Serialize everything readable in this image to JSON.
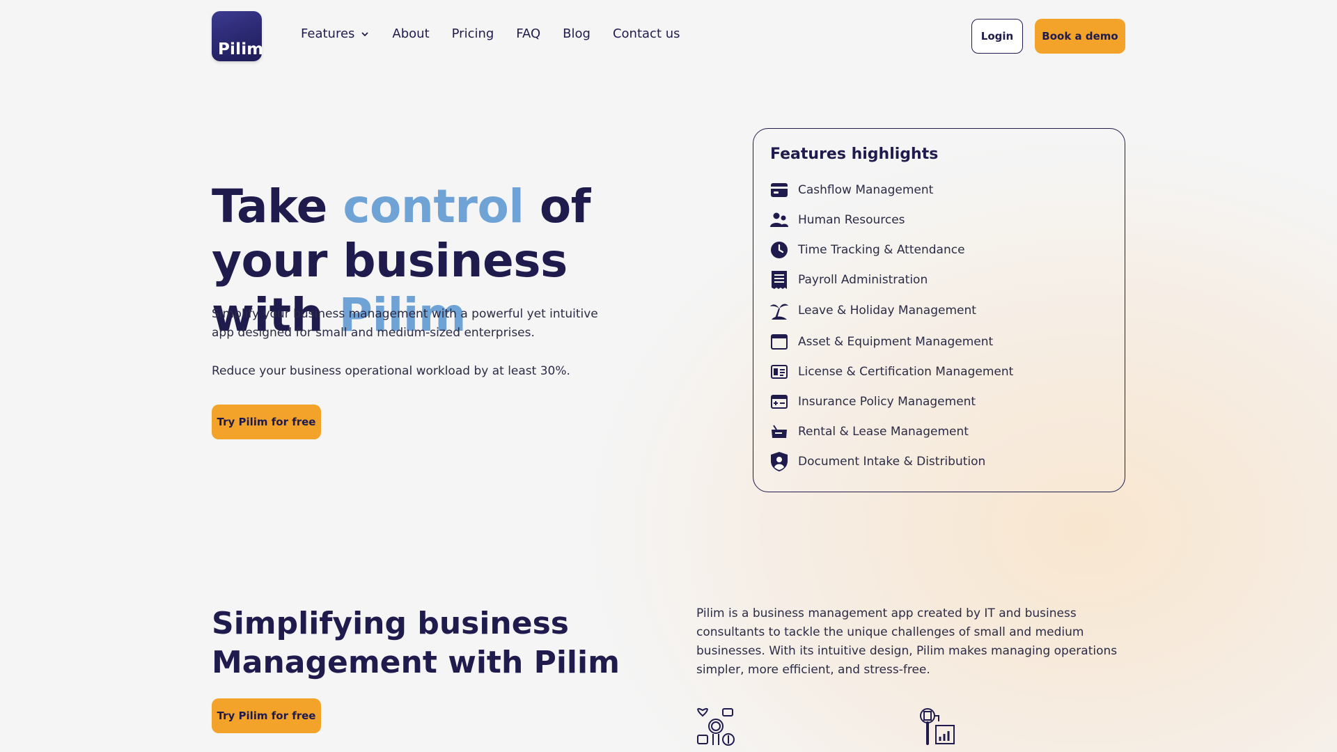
{
  "nav": {
    "logo_text": "Pilim",
    "links": [
      "Features",
      "About",
      "Pricing",
      "FAQ",
      "Blog",
      "Contact us"
    ],
    "login_label": "Login",
    "demo_label": "Book a demo"
  },
  "hero": {
    "title_part1": "Take ",
    "title_accent1": "control",
    "title_part2": " of your business with ",
    "title_accent2": "Pilim",
    "para1": "Simplify your business management with a powerful yet intuitive app designed for small and medium-sized enterprises.",
    "para2": "Reduce your business operational workload by at least 30%.",
    "cta_label": "Try Pilim for free"
  },
  "features": {
    "heading": "Features highlights",
    "items": [
      {
        "label": "Cashflow Management",
        "icon": "wallet-icon"
      },
      {
        "label": "Human Resources",
        "icon": "people-icon"
      },
      {
        "label": "Time Tracking & Attendance",
        "icon": "clock-icon"
      },
      {
        "label": "Payroll Administration",
        "icon": "receipt-icon"
      },
      {
        "label": "Leave & Holiday Management",
        "icon": "palm-tree-icon"
      },
      {
        "label": "Asset & Equipment Management",
        "icon": "window-icon"
      },
      {
        "label": "License & Certification Management",
        "icon": "id-card-icon"
      },
      {
        "label": "Insurance Policy Management",
        "icon": "medical-card-icon"
      },
      {
        "label": "Rental & Lease Management",
        "icon": "rent-tag-icon"
      },
      {
        "label": "Document Intake & Distribution",
        "icon": "user-shield-icon"
      }
    ]
  },
  "section2": {
    "title": "Simplifying business Management with Pilim",
    "para": "Pilim is a business management app created by IT and business consultants to tackle the unique challenges of small and medium businesses. With its intuitive design, Pilim makes managing operations simpler, more efficient, and stress-free.",
    "cta_label": "Try Pilim for free"
  },
  "colors": {
    "primary": "#1f1b4d",
    "accent_text": "#6fa2d5",
    "cta": "#f3a32a"
  }
}
